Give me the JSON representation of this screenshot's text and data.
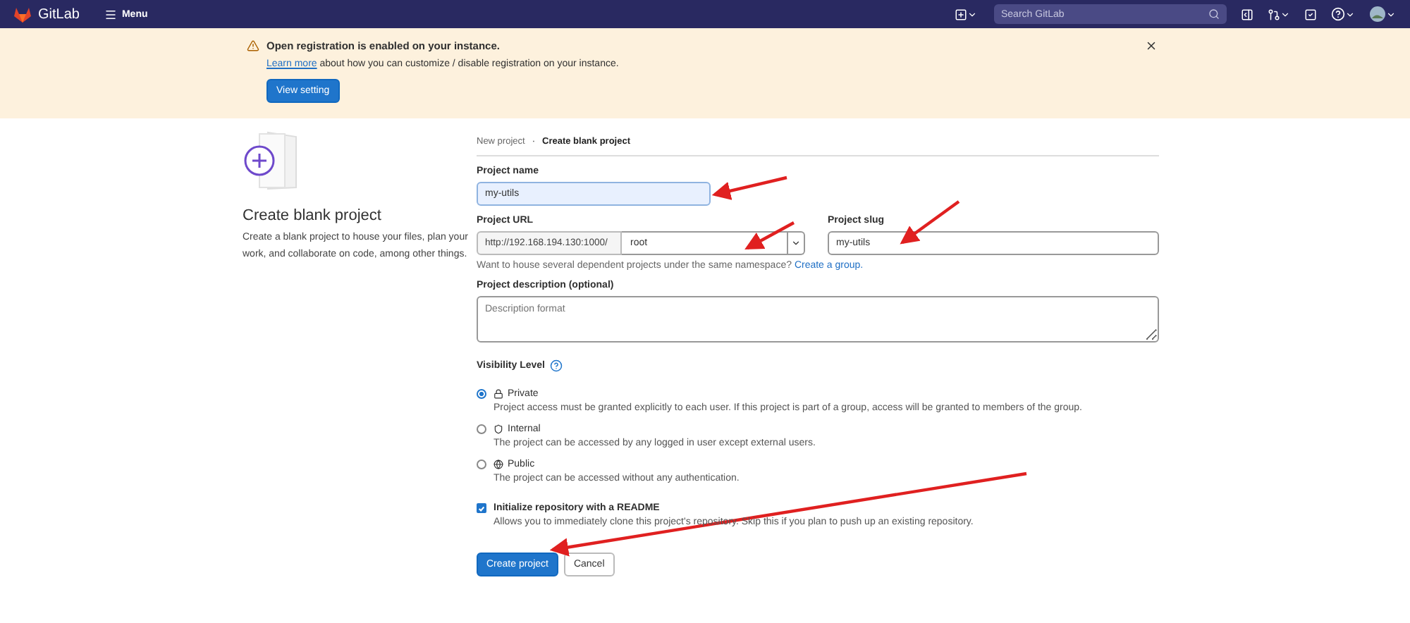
{
  "header": {
    "logo_text": "GitLab",
    "menu_label": "Menu",
    "search_placeholder": "Search GitLab"
  },
  "banner": {
    "title": "Open registration is enabled on your instance.",
    "link": "Learn more",
    "message": " about how you can customize / disable registration on your instance.",
    "button": "View setting"
  },
  "intro": {
    "heading": "Create blank project",
    "description": "Create a blank project to house your files, plan your work, and collaborate on code, among other things."
  },
  "breadcrumb": {
    "separator": "·",
    "items": [
      {
        "label": "New project",
        "current": false
      },
      {
        "label": "Create blank project",
        "current": true
      }
    ]
  },
  "form": {
    "name_label": "Project name",
    "name_value": "my-utils",
    "url_label": "Project URL",
    "url_prefix": "http://192.168.194.130:1000/",
    "namespace": "root",
    "slug_label": "Project slug",
    "slug_value": "my-utils",
    "help": "Want to house several dependent projects under the same namespace? ",
    "help_link": "Create a group.",
    "description_label": "Project description (optional)",
    "description_placeholder": "Description format",
    "visibility_label": "Visibility Level",
    "visibility": [
      {
        "label": "Private",
        "description": "Project access must be granted explicitly to each user. If this project is part of a group, access will be granted to members of the group.",
        "selected": true
      },
      {
        "label": "Internal",
        "description": "The project can be accessed by any logged in user except external users.",
        "selected": false
      },
      {
        "label": "Public",
        "description": "The project can be accessed without any authentication.",
        "selected": false
      }
    ],
    "readme": {
      "label": "Initialize repository with a README",
      "description": "Allows you to immediately clone this project's repository. Skip this if you plan to push up an existing repository.",
      "checked": true
    },
    "buttons": [
      {
        "label": "Create project",
        "kind": "primary"
      },
      {
        "label": "Cancel",
        "kind": "secondary"
      }
    ]
  }
}
